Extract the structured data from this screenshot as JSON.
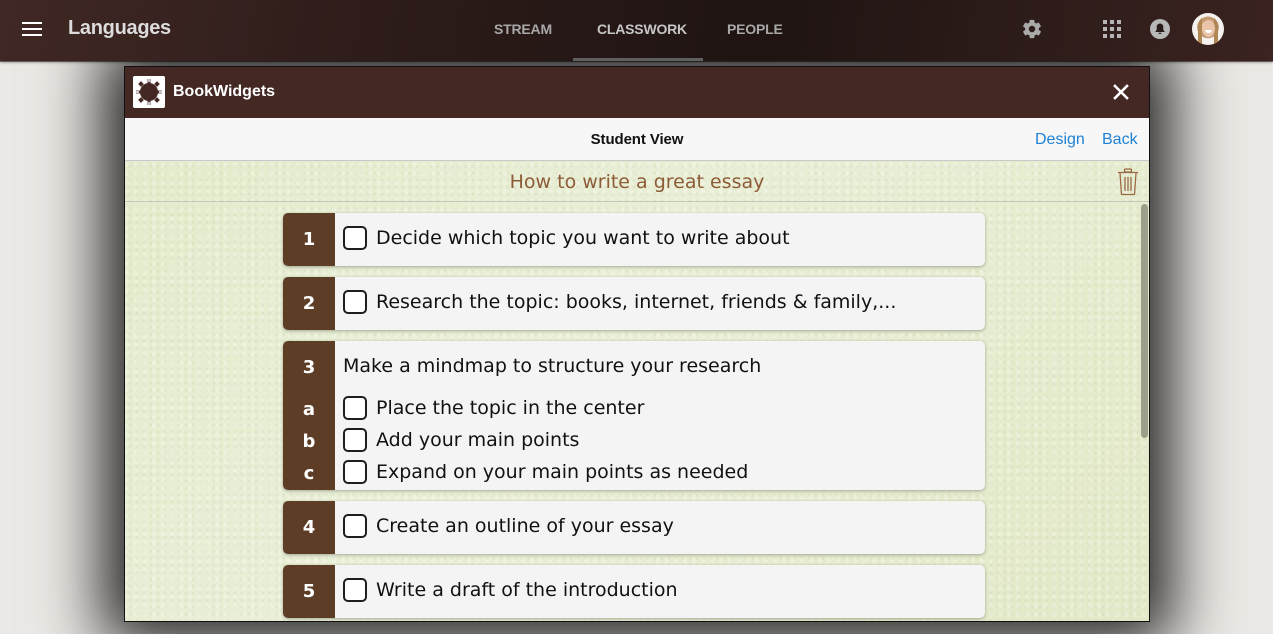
{
  "appbar": {
    "title": "Languages",
    "tabs": [
      {
        "label": "STREAM",
        "active": false
      },
      {
        "label": "CLASSWORK",
        "active": true
      },
      {
        "label": "PEOPLE",
        "active": false
      }
    ],
    "icons": [
      "menu-icon",
      "settings-gear-icon",
      "apps-grid-icon",
      "notifications-bell-icon",
      "user-avatar"
    ]
  },
  "dialog": {
    "brand": "BookWidgets",
    "toolbar": {
      "title": "Student View",
      "design_label": "Design",
      "back_label": "Back"
    },
    "worksheet": {
      "title": "How to write a great essay",
      "accent_color": "#5e3d26",
      "title_color": "#8d5b36",
      "link_color": "#1f82d6",
      "items": [
        {
          "number": "1",
          "text": "Decide which topic you want to write about",
          "checked": false
        },
        {
          "number": "2",
          "text": "Research the topic: books, internet, friends & family,...",
          "checked": false
        },
        {
          "number": "3",
          "text": "Make a mindmap to structure your research",
          "subitems": [
            {
              "letter": "a",
              "text": "Place the topic in the center",
              "checked": false
            },
            {
              "letter": "b",
              "text": "Add your main points",
              "checked": false
            },
            {
              "letter": "c",
              "text": "Expand on your main points as needed",
              "checked": false
            }
          ]
        },
        {
          "number": "4",
          "text": "Create an outline of your essay",
          "checked": false
        },
        {
          "number": "5",
          "text": "Write a draft of the introduction",
          "checked": false
        }
      ]
    }
  }
}
